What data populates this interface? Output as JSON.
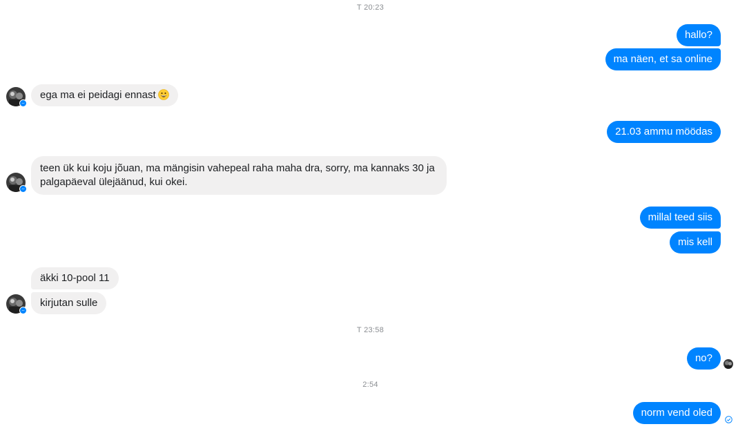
{
  "timestamps": {
    "t1": "T 20:23",
    "t2": "T 23:58",
    "t3": "2:54"
  },
  "messages": {
    "m1": "hallo?",
    "m2": "ma näen, et sa online",
    "m3": "ega ma ei peidagi ennast",
    "m4": "21.03 ammu möödas",
    "m5": "teen ük kui koju jõuan, ma mängisin vahepeal raha maha dra, sorry, ma kannaks 30 ja palgapäeval ülejäänud, kui okei.",
    "m6": "millal teed siis",
    "m7": "mis kell",
    "m8": "äkki 10-pool 11",
    "m9": "kirjutan sulle",
    "m10": "no?",
    "m11": "norm vend oled"
  },
  "icons": {
    "emoji": "grinning-face-emoji",
    "messenger_badge": "messenger-badge-icon",
    "seen": "seen-avatar",
    "sent": "sent-check-icon"
  },
  "colors": {
    "outgoing_bubble": "#0084ff",
    "incoming_bubble": "#f1f0f0",
    "timestamp": "#8a8d91"
  }
}
